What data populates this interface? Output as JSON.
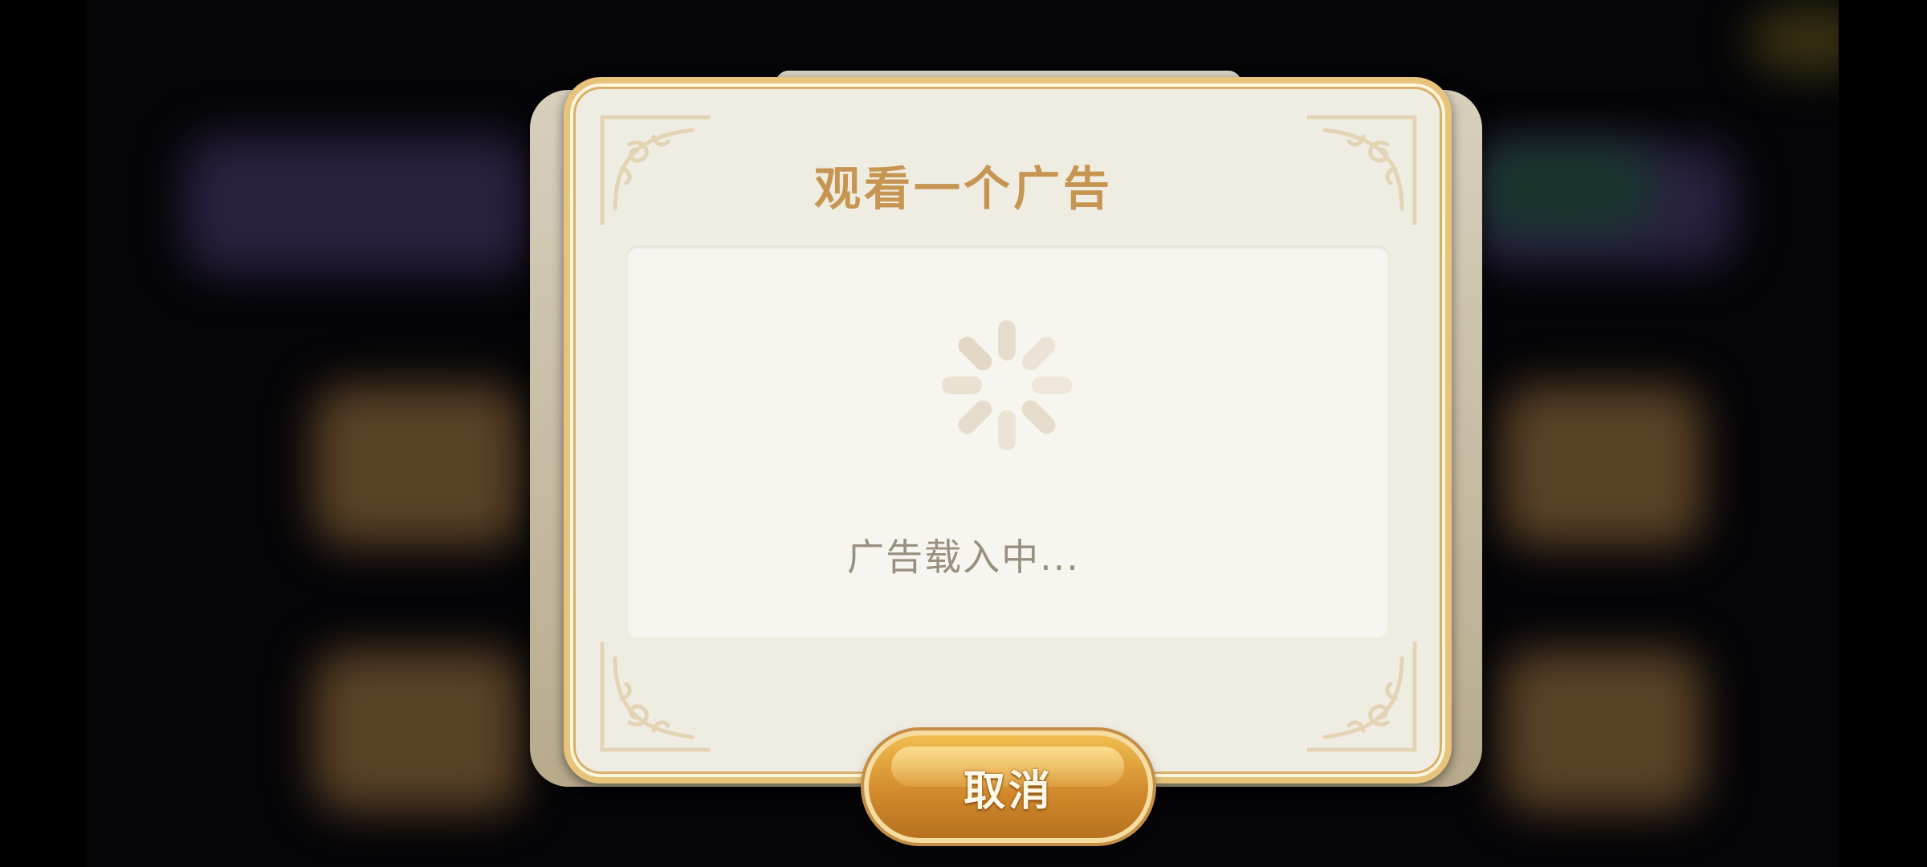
{
  "dialog": {
    "title": "观看一个广告",
    "loading_text": "广告载入中...",
    "cancel_label": "取消"
  },
  "icons": {
    "spinner": "loading-spinner-icon",
    "corner": "ornament-corner-icon"
  },
  "colors": {
    "title": "#c69552",
    "panel": "#f7f5ef",
    "dialog_bg": "#efece2",
    "gold_border": "#e7c37c",
    "button": "#d28a2c",
    "loading_text": "#9a8f7f"
  }
}
